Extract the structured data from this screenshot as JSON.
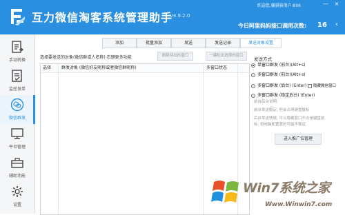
{
  "header": {
    "title": "互力微信淘客系统管理助手",
    "version": "V3.9.2.0",
    "welcome": "欢迎您,骥骐骑用户:806",
    "count_label": "今日阿里妈妈接口调用次数:",
    "count_value": "16",
    "win_min": "—",
    "win_close": "×",
    "nav_arrow": "‹",
    "color": "#2a8fe0"
  },
  "sidebar": {
    "items": [
      {
        "label": "手动转换",
        "icon": "document-convert-icon"
      },
      {
        "label": "监控发单",
        "icon": "monitor-document-icon"
      },
      {
        "label": "微信群发",
        "icon": "wechat-broadcast-icon",
        "active": true
      },
      {
        "label": "平台管理",
        "icon": "monitor-screen-icon"
      },
      {
        "label": "辅助功能",
        "icon": "toolbox-icon"
      },
      {
        "label": "设置",
        "icon": "gear-icon"
      }
    ]
  },
  "tabs": [
    "添加",
    "批量添加",
    "发送",
    "发送记录",
    "发送对象设置"
  ],
  "active_tab": "发送对象设置",
  "main": {
    "instruction": "选择要发送的对象(微信群或人名称)  右键更多功能",
    "refresh_button": "刷新待出的窗口",
    "detect_button": "一键检出选择的窗口",
    "table": {
      "columns": [
        "选择",
        "群发对象 (微信好友昵称或者微信群昵称)",
        "多窗口状态"
      ]
    }
  },
  "send_panel": {
    "title": "发送方式",
    "options": [
      {
        "label": "单窗口群发 (前台)(Alt+s)",
        "checked": true
      },
      {
        "label": "多窗口群发 (前台)(Alt+s)",
        "checked": false
      },
      {
        "label": "多窗口群发 (后台) (Enter)",
        "checked": false
      },
      {
        "label": "多窗口群发 (稳定后台) (Enter)",
        "checked": false
      }
    ],
    "hide_checkbox_label": "隐藏微信窗口",
    "notes": [
      "前台后台说明:",
      "前台发送稳定, 但会占用键盘鼠标",
      "后台发送快速, 可以隐藏窗口不占用键盘鼠",
      "标, 但电脑配置差的可能不稳定"
    ],
    "promo_button": "进入推广位管理"
  },
  "watermark": {
    "brand": "Win7系统之家",
    "url": "Www.Winwin7.com"
  }
}
